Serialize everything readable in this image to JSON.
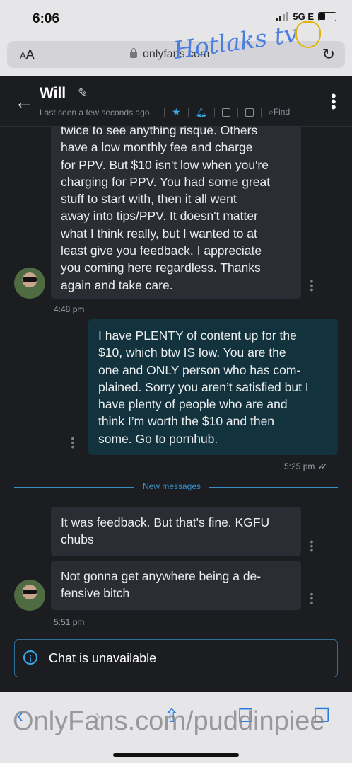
{
  "status_bar": {
    "time": "6:06",
    "network": "5G E"
  },
  "browser": {
    "text_size": "AA",
    "url": "onlyfans.com",
    "watermark": "Hotlaks tv"
  },
  "chat_header": {
    "name": "Will",
    "last_seen": "Last seen a few seconds ago",
    "find_label": "Find"
  },
  "messages": [
    {
      "direction": "in",
      "lines": [
        "twice to see anything risque. Others",
        "have a low monthly fee and charge",
        "for PPV. But $10 isn't low when you're",
        "charging for PPV. You had some great",
        "stuff to start with, then it all went",
        "away into tips/PPV. It doesn't matter",
        "what I think really, but I wanted to at",
        "least give you feedback. I appreciate",
        "you coming here regardless. Thanks",
        "again and take care."
      ],
      "time": "4:48 pm"
    },
    {
      "direction": "out",
      "lines": [
        "I have PLENTY of content up for the",
        "$10, which btw IS low. You are the",
        "one and ONLY person who has com-",
        "plained. Sorry you aren’t satisfied but I",
        "have plenty of people who are and",
        "think I’m worth the $10 and then",
        "some. Go to pornhub."
      ],
      "time": "5:25 pm"
    },
    {
      "direction": "in",
      "lines": [
        "It was feedback. But that's fine. KGFU",
        "chubs"
      ]
    },
    {
      "direction": "in",
      "lines": [
        "Not gonna get anywhere being a de-",
        "fensive bitch"
      ],
      "time": "5:51 pm"
    }
  ],
  "new_messages_label": "New messages",
  "chat_unavailable": "Chat is unavailable",
  "bottom_watermark": "OnlyFans.com/puddinpiee",
  "colors": {
    "accent": "#3aa6e4",
    "bubble_in": "#2a2d33",
    "bubble_out": "#12323e",
    "background": "#1b1d21"
  }
}
